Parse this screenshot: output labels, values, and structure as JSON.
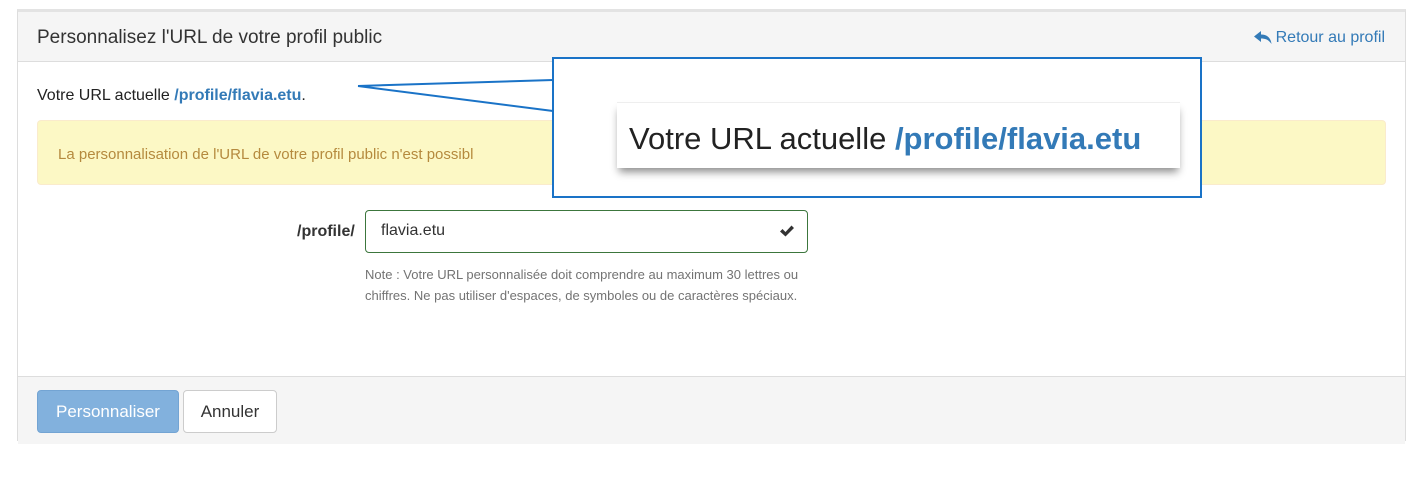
{
  "header": {
    "title": "Personnalisez l'URL de votre profil public",
    "back_label": "Retour au profil",
    "back_icon": "reply-arrow-icon"
  },
  "current_url": {
    "prefix": "Votre URL actuelle ",
    "link": "/profile/flavia.etu",
    "suffix": "."
  },
  "alert": {
    "text": "La personnalisation de l'URL de votre profil public n'est possibl"
  },
  "form": {
    "label": "/profile/",
    "value": "flavia.etu",
    "valid_icon": "checkmark-icon",
    "help": "Note : Votre URL personnalisée doit comprendre au maximum 30 lettres ou chiffres. Ne pas utiliser d'espaces, de symboles ou de caractères spéciaux."
  },
  "footer": {
    "submit_label": "Personnaliser",
    "cancel_label": "Annuler"
  },
  "callout": {
    "prefix": "Votre URL actuelle ",
    "link": "/profile/flavia.etu"
  },
  "colors": {
    "link": "#337ab7",
    "callout_border": "#1a73c7",
    "alert_bg": "#fcf8c5",
    "alert_text": "#b58a3e",
    "valid_border": "#3c763d"
  }
}
